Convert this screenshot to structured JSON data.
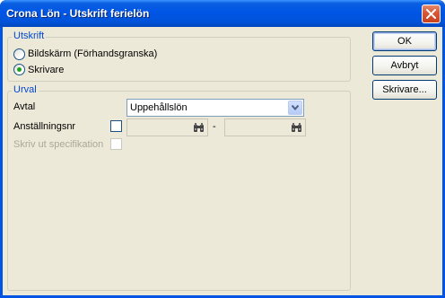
{
  "window": {
    "title": "Crona Lön - Utskrift ferielön"
  },
  "utskrift": {
    "label": "Utskrift",
    "options": [
      {
        "label": "Bildskärm (Förhandsgranska)",
        "selected": false
      },
      {
        "label": "Skrivare",
        "selected": true
      }
    ]
  },
  "urval": {
    "label": "Urval",
    "avtal_label": "Avtal",
    "avtal_value": "Uppehållslön",
    "anstallningsnr_label": "Anställningsnr",
    "anstallningsnr_checked": false,
    "from_value": "",
    "range_separator": "-",
    "to_value": "",
    "specifikation_label": "Skriv ut specifikation",
    "specifikation_checked": false
  },
  "buttons": {
    "ok": "OK",
    "avbryt": "Avbryt",
    "skrivare": "Skrivare..."
  },
  "colors": {
    "titlebar": "#0055e5",
    "dialog_bg": "#ece9d8",
    "group_label": "#0046d5",
    "radio_dot": "#21a121"
  }
}
